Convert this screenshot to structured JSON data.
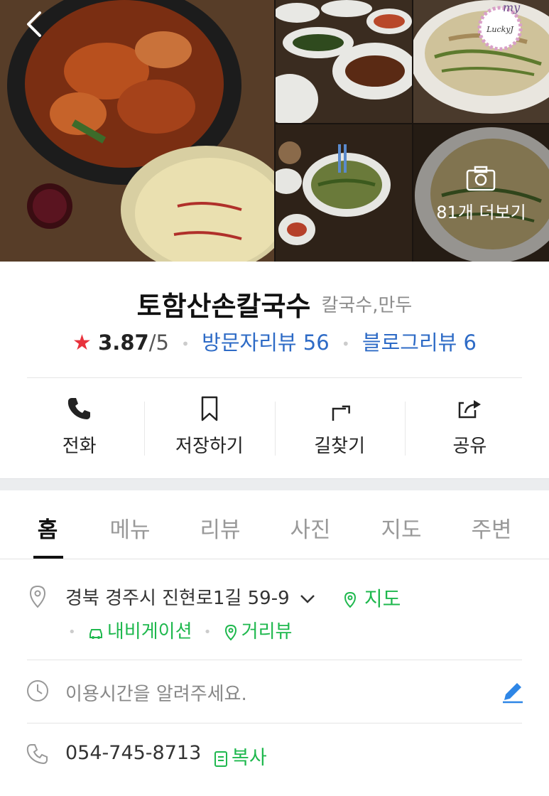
{
  "photos": {
    "more_count_label": "81개 더보기",
    "watermark_top": "my",
    "watermark_name": "LuckyJ"
  },
  "place": {
    "name": "토함산손칼국수",
    "category": "칼국수,만두",
    "rating_star": "★",
    "rating": "3.87",
    "rating_max": "/5",
    "visitor_reviews": "방문자리뷰 56",
    "blog_reviews": "블로그리뷰 6"
  },
  "actions": [
    {
      "label": "전화",
      "icon": "phone-icon"
    },
    {
      "label": "저장하기",
      "icon": "bookmark-icon"
    },
    {
      "label": "길찾기",
      "icon": "directions-icon"
    },
    {
      "label": "공유",
      "icon": "share-icon"
    }
  ],
  "tabs": [
    {
      "label": "홈",
      "active": true
    },
    {
      "label": "메뉴"
    },
    {
      "label": "리뷰"
    },
    {
      "label": "사진"
    },
    {
      "label": "지도"
    },
    {
      "label": "주변"
    }
  ],
  "info": {
    "address": "경북 경주시 진현로1길 59-9",
    "map_link": "지도",
    "navigation_link": "내비게이션",
    "street_view_link": "거리뷰",
    "hours_prompt": "이용시간을 알려주세요.",
    "phone": "054-745-8713",
    "copy_label": "복사"
  },
  "colors": {
    "accent_green": "#1fb84e",
    "link_blue": "#2e6bc6",
    "star_red": "#e8323c"
  }
}
